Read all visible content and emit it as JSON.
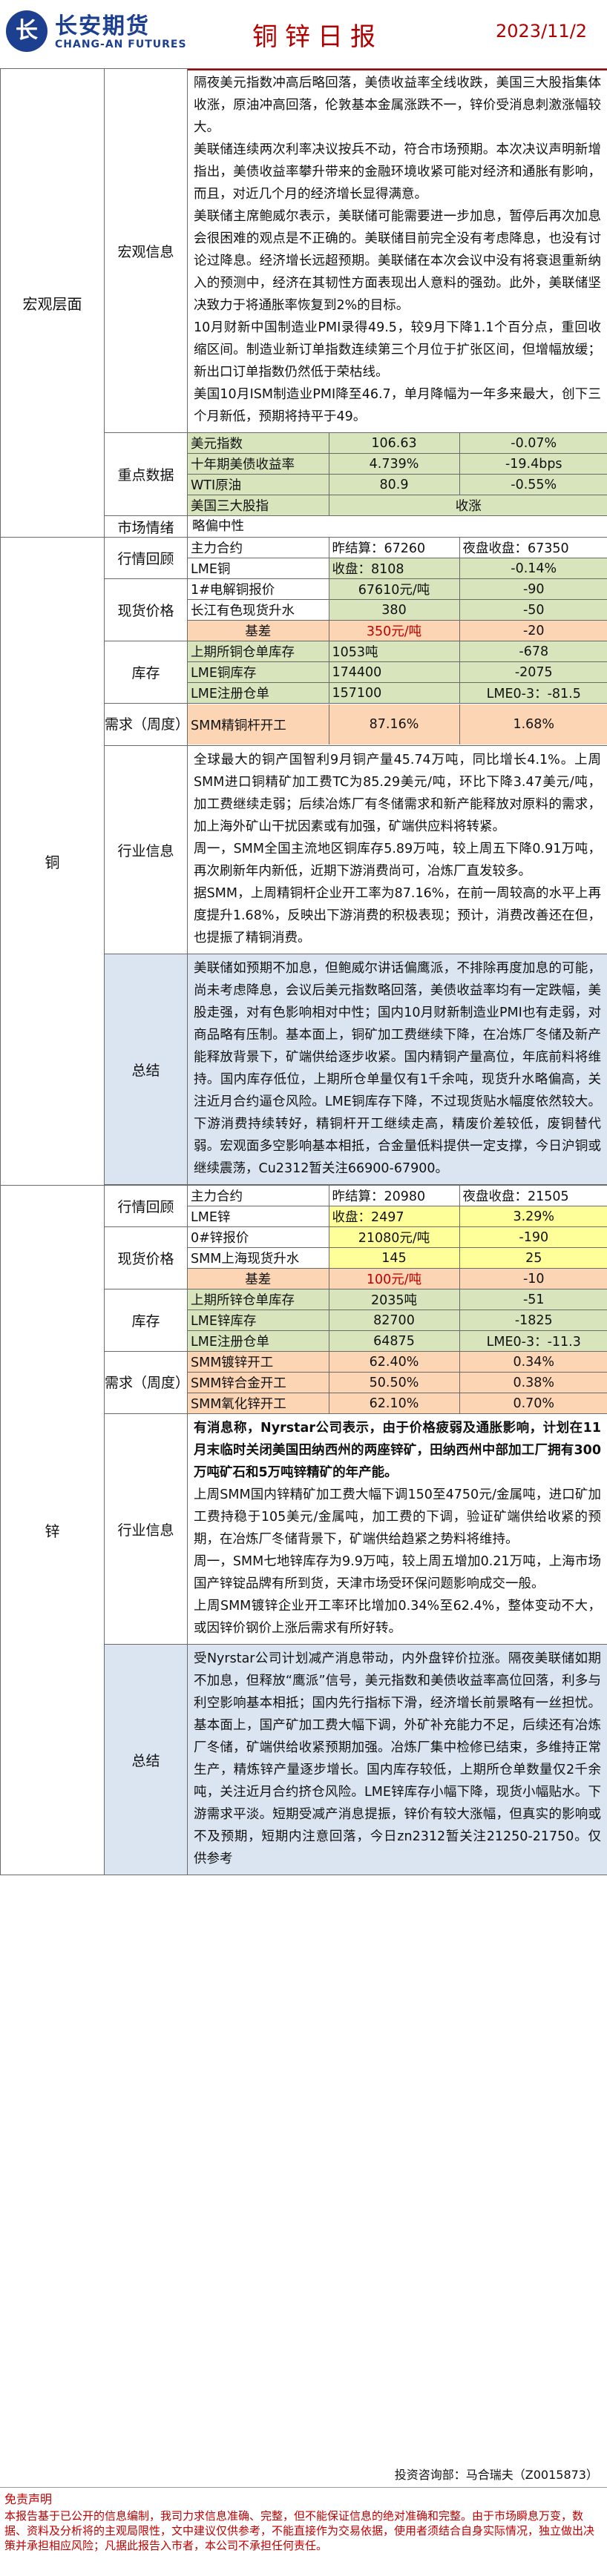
{
  "header": {
    "logo_mark": "长",
    "logo_cn": "长安期货",
    "logo_en": "CHANG-AN FUTURES",
    "title": "铜锌日报",
    "date": "2023/11/2"
  },
  "macro": {
    "section_label": "宏观层面",
    "info_label": "宏观信息",
    "paragraphs": [
      "隔夜美元指数冲高后略回落，美债收益率全线收跌，美国三大股指集体收涨，原油冲高回落，伦敦基本金属涨跌不一，锌价受消息刺激涨幅较大。",
      "美联储连续两次利率决议按兵不动，符合市场预期。本次决议声明新增指出，美债收益率攀升带来的金融环境收紧可能对经济和通胀有影响，而且，对近几个月的经济增长显得满意。",
      "美联储主席鲍威尔表示，美联储可能需要进一步加息，暂停后再次加息会很困难的观点是不正确的。美联储目前完全没有考虑降息，也没有讨论过降息。经济增长远超预期。美联储在本次会议中没有将衰退重新纳入的预测中，经济在其韧性方面表现出人意料的强劲。此外，美联储坚决致力于将通胀率恢复到2%的目标。",
      "10月财新中国制造业PMI录得49.5，较9月下降1.1个百分点，重回收缩区间。制造业新订单指数连续第三个月位于扩张区间，但增幅放缓；新出口订单指数仍然低于荣枯线。",
      "美国10月ISM制造业PMI降至46.7，单月降幅为一年多来最大，创下三个月新低，预期将持平于49。"
    ],
    "key_data_label": "重点数据",
    "key_data": [
      {
        "name": "美元指数",
        "value": "106.63",
        "change": "-0.07%"
      },
      {
        "name": "十年期美债收益率",
        "value": "4.739%",
        "change": "-19.4bps"
      },
      {
        "name": "WTI原油",
        "value": "80.9",
        "change": "-0.55%"
      },
      {
        "name": "美国三大股指",
        "value": "收涨"
      }
    ],
    "sentiment_label": "市场情绪",
    "sentiment_value": "略偏中性"
  },
  "copper": {
    "section_label": "铜",
    "market_label": "行情回顾",
    "market_rows": [
      [
        "主力合约",
        "昨结算：67260",
        "夜盘收盘：67350"
      ],
      [
        "LME铜",
        "收盘：8108",
        "-0.14%"
      ]
    ],
    "spot_label": "现货价格",
    "spot_rows": [
      [
        "1#电解铜报价",
        "67610元/吨",
        "-90"
      ],
      [
        "长江有色现货升水",
        "380",
        "-50"
      ],
      [
        "基差",
        "350元/吨",
        "-20"
      ]
    ],
    "stock_label": "库存",
    "stock_rows": [
      [
        "上期所铜仓单库存",
        "1053吨",
        "-678"
      ],
      [
        "LME铜库存",
        "174400",
        "-2075"
      ],
      [
        "LME注册仓单",
        "157100",
        "LME0-3：-81.5"
      ]
    ],
    "demand_label": "需求（周度）",
    "demand_rows": [
      [
        "SMM精铜杆开工",
        "87.16%",
        "1.68%"
      ]
    ],
    "industry_label": "行业信息",
    "industry_paragraphs": [
      "全球最大的铜产国智利9月铜产量45.74万吨，同比增长4.1%。上周SMM进口铜精矿加工费TC为85.29美元/吨，环比下降3.47美元/吨，加工费继续走弱；后续冶炼厂有冬储需求和新产能释放对原料的需求，加上海外矿山干扰因素或有加强，矿端供应料将转紧。",
      "周一，SMM全国主流地区铜库存5.89万吨，较上周五下降0.91万吨，再次刷新年内新低，近期下游消费尚可，冶炼厂直发较多。",
      "据SMM，上周精铜杆企业开工率为87.16%，在前一周较高的水平上再度提升1.68%，反映出下游消费的积极表现；预计，消费改善还在但，也提振了精铜消费。"
    ],
    "summary_label": "总结",
    "summary_text": "美联储如预期不加息，但鲍威尔讲话偏鹰派，不排除再度加息的可能，尚未考虑降息，会议后美元指数略回落，美债收益率均有一定跌幅，美股走强，对有色影响相对中性；国内10月财新制造业PMI也有走弱，对商品略有压制。基本面上，铜矿加工费继续下降，在冶炼厂冬储及新产能释放背景下，矿端供给逐步收紧。国内精铜产量高位，年底前料将维持。国内库存低位，上期所仓单量仅有1千余吨，现货升水略偏高，关注近月合约逼仓风险。LME铜库存下降，不过现货贴水幅度依然较大。下游消费持续转好，精铜杆开工继续走高，精废价差较低，废铜替代弱。宏观面多空影响基本相抵，合金量低料提供一定支撑，今日沪铜或继续震荡，Cu2312暂关注66900-67900。"
  },
  "zinc": {
    "section_label": "锌",
    "market_label": "行情回顾",
    "market_rows": [
      [
        "主力合约",
        "昨结算：20980",
        "夜盘收盘：21505"
      ],
      [
        "LME锌",
        "收盘：2497",
        "3.29%"
      ]
    ],
    "spot_label": "现货价格",
    "spot_rows": [
      [
        "0#锌报价",
        "21080元/吨",
        "-190"
      ],
      [
        "SMM上海现货升水",
        "145",
        "25"
      ],
      [
        "基差",
        "100元/吨",
        "-10"
      ]
    ],
    "stock_label": "库存",
    "stock_rows": [
      [
        "上期所锌仓单库存",
        "2035吨",
        "-51"
      ],
      [
        "LME锌库存",
        "82700",
        "-1825"
      ],
      [
        "LME注册仓单",
        "64875",
        "LME0-3：-11.3"
      ]
    ],
    "demand_label": "需求（周度）",
    "demand_rows": [
      [
        "SMM镀锌开工",
        "62.40%",
        "0.34%"
      ],
      [
        "SMM锌合金开工",
        "50.50%",
        "0.38%"
      ],
      [
        "SMM氧化锌开工",
        "62.10%",
        "0.70%"
      ]
    ],
    "industry_label": "行业信息",
    "industry_paragraphs": [
      "有消息称，Nyrstar公司表示，由于价格疲弱及通胀影响，计划在11月末临时关闭美国田纳西州的两座锌矿，田纳西州中部加工厂拥有300万吨矿石和5万吨锌精矿的年产能。",
      "上周SMM国内锌精矿加工费大幅下调150至4750元/金属吨，进口矿加工费持稳于105美元/金属吨，加工费的下调，验证矿端供给收紧的预期，在冶炼厂冬储背景下，矿端供给趋紧之势料将维持。",
      "周一，SMM七地锌库存为9.9万吨，较上周五增加0.21万吨，上海市场国产锌锭品牌有所到货，天津市场受环保问题影响成交一般。",
      "上周SMM镀锌企业开工率环比增加0.34%至62.4%，整体变动不大，或因锌价钢价上涨后需求有所好转。"
    ],
    "summary_label": "总结",
    "summary_text": "受Nyrstar公司计划减产消息带动，内外盘锌价拉涨。隔夜美联储如期不加息，但释放“鹰派”信号，美元指数和美债收益率高位回落，利多与利空影响基本相抵；国内先行指标下滑，经济增长前景略有一丝担忧。基本面上，国产矿加工费大幅下调，外矿补充能力不足，后续还有冶炼厂冬储，矿端供给收紧预期加强。冶炼厂集中检修已结束，多维持正常生产，精炼锌产量逐步增长。国内库存较低，上期所仓单数量仅2千余吨，关注近月合约挤仓风险。LME锌库存小幅下降，现货小幅贴水。下游需求平淡。短期受减产消息提振，锌价有较大涨幅，但真实的影响或不及预期，短期内注意回落，今日zn2312暂关注21250-21750。仅供参考"
  },
  "footer": {
    "analyst": "投资咨询部：马合瑞夫（Z0015873）",
    "disclaimer_title": "免责声明",
    "disclaimer_text": "本报告基于已公开的信息编制，我司力求信息准确、完整，但不能保证信息的绝对准确和完整。由于市场瞬息万变，数据、资料及分析将的主观局限性，文中建议仅供参考，不能直接作为交易依据，使用者须结合自身实际情况，独立做出决策并承担相应风险；凡据此报告入市者，本公司不承担任何责任。"
  }
}
